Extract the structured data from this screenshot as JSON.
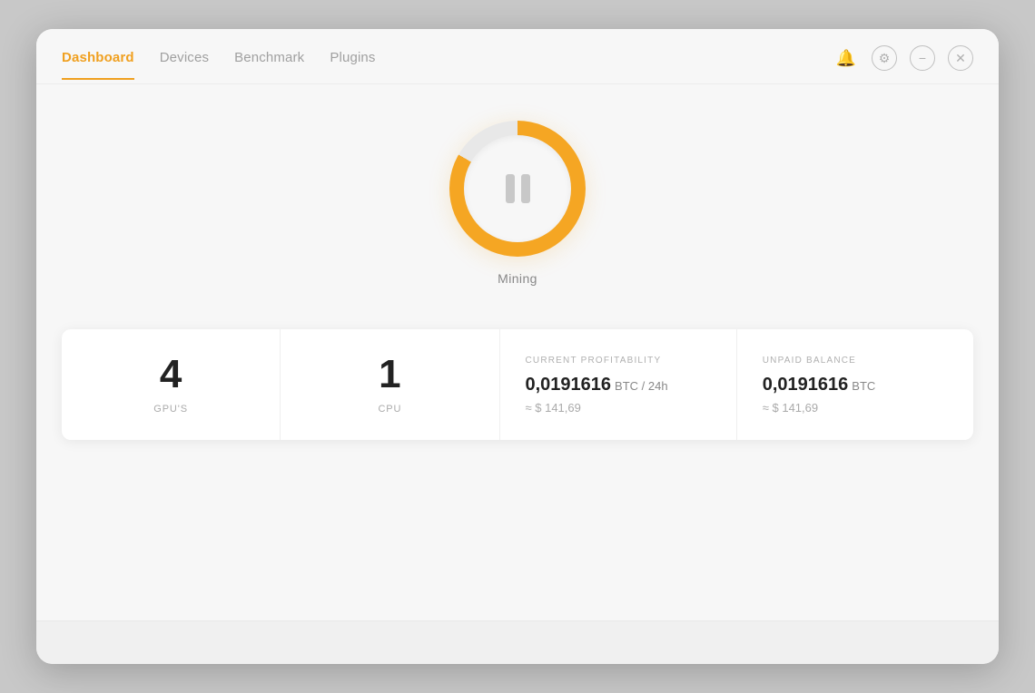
{
  "nav": {
    "tabs": [
      {
        "id": "dashboard",
        "label": "Dashboard",
        "active": true
      },
      {
        "id": "devices",
        "label": "Devices",
        "active": false
      },
      {
        "id": "benchmark",
        "label": "Benchmark",
        "active": false
      },
      {
        "id": "plugins",
        "label": "Plugins",
        "active": false
      }
    ]
  },
  "window_controls": {
    "bell_label": "🔔",
    "gear_label": "⚙",
    "minimize_label": "−",
    "close_label": "✕"
  },
  "mining": {
    "status_label": "Mining"
  },
  "stats": {
    "gpu": {
      "value": "4",
      "label": "GPU'S"
    },
    "cpu": {
      "value": "1",
      "label": "CPU"
    },
    "profitability": {
      "section_label": "CURRENT PROFITABILITY",
      "btc_value": "0,0191616",
      "btc_unit": "BTC / 24h",
      "usd_approx": "≈ $ 141,69"
    },
    "balance": {
      "section_label": "UNPAID BALANCE",
      "btc_value": "0,0191616",
      "btc_unit": "BTC",
      "usd_approx": "≈ $ 141,69"
    }
  }
}
